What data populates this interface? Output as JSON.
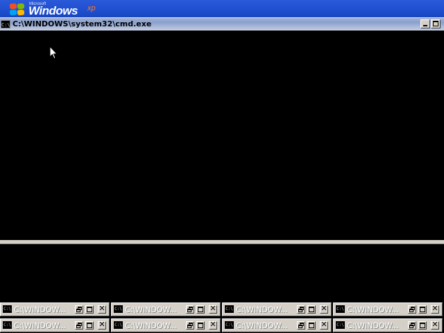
{
  "desktop": {
    "logo": {
      "microsoft": "Microsoft",
      "windows": "Windows",
      "xp": "xp"
    }
  },
  "main_window": {
    "icon_label": "C:\\",
    "title": "C:\\WINDOWS\\system32\\cmd.exe",
    "buttons": {
      "minimize": "minimize-icon",
      "maximize": "maximize-icon"
    }
  },
  "minimized_windows": {
    "icon_label": "C:\\",
    "title": "C:\\WINDOW...",
    "rows": [
      [
        {
          "title": "C:\\WINDOW..."
        },
        {
          "title": "C:\\WINDOW..."
        },
        {
          "title": "C:\\WINDOW..."
        },
        {
          "title": "C:\\WINDOW..."
        }
      ],
      [
        {
          "title": "C:\\WINDOW..."
        },
        {
          "title": "C:\\WINDOW..."
        },
        {
          "title": "C:\\WINDOW..."
        },
        {
          "title": "C:\\WINDOW..."
        }
      ]
    ]
  }
}
